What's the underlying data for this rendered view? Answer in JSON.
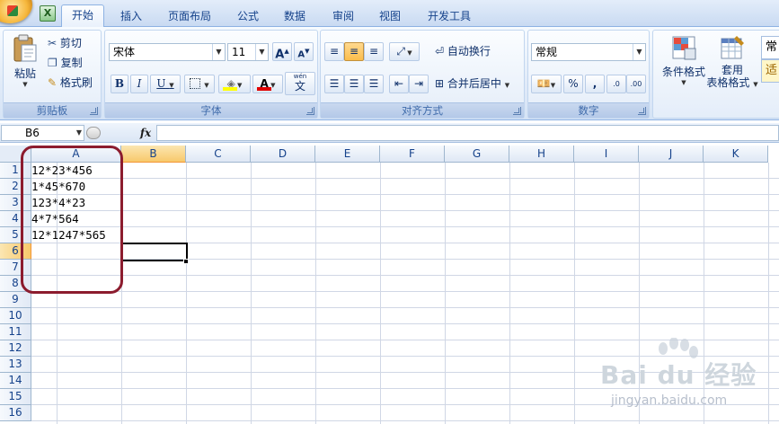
{
  "tabs": [
    "开始",
    "插入",
    "页面布局",
    "公式",
    "数据",
    "审阅",
    "视图",
    "开发工具"
  ],
  "qat": {
    "excel_icon": "X"
  },
  "clipboard": {
    "paste": "粘贴",
    "cut": "剪切",
    "copy": "复制",
    "format_painter": "格式刷",
    "label": "剪贴板"
  },
  "font": {
    "name": "宋体",
    "size": "11",
    "grow": "A",
    "shrink": "A",
    "bold": "B",
    "italic": "I",
    "underline": "U",
    "font_color": "A",
    "phonetic": "文",
    "phonetic_top": "wén",
    "label": "字体"
  },
  "alignment": {
    "wrap_text": "自动换行",
    "merge_center": "合并后居中",
    "label": "对齐方式"
  },
  "number": {
    "format": "常规",
    "percent": "%",
    "comma": ",",
    "inc_decimal": ".0",
    "dec_decimal": ".00",
    "label": "数字"
  },
  "styles": {
    "conditional": "条件格式",
    "table_format_line1": "套用",
    "table_format_line2": "表格格式",
    "style_normal": "常",
    "style_good": "适"
  },
  "formula_bar": {
    "name_box": "B6",
    "fx": "fx",
    "value": ""
  },
  "columns": [
    "A",
    "B",
    "C",
    "D",
    "E",
    "F",
    "G",
    "H",
    "I",
    "J",
    "K"
  ],
  "rows": [
    "1",
    "2",
    "3",
    "4",
    "5",
    "6",
    "7",
    "8",
    "9",
    "10",
    "11",
    "12",
    "13",
    "14",
    "15",
    "16"
  ],
  "cells": [
    {
      "ref": "A1",
      "value": "12*23*456"
    },
    {
      "ref": "A2",
      "value": "1*45*670"
    },
    {
      "ref": "A3",
      "value": "123*4*23"
    },
    {
      "ref": "A4",
      "value": "4*7*564"
    },
    {
      "ref": "A5",
      "value": "12*1247*565"
    }
  ],
  "selection": {
    "cell": "B6",
    "column": "B",
    "row": "6"
  },
  "watermark": {
    "brand": "Bai du 经验",
    "url": "jingyan.baidu.com"
  },
  "colors": {
    "accent": "#15428b",
    "selection_orange": "#f8c96b",
    "annotation_oval": "#8c1c2e"
  }
}
